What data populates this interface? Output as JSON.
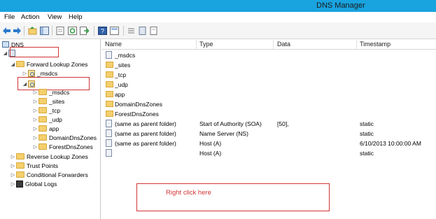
{
  "window": {
    "title": "DNS Manager"
  },
  "menu": [
    "File",
    "Action",
    "View",
    "Help"
  ],
  "tree": {
    "root": "DNS",
    "server": "",
    "forward_lookup_zones": "Forward Lookup Zones",
    "msdcs_zone": "_msdcs",
    "selected_zone": "",
    "subfolders": [
      "_msdcs",
      "_sites",
      "_tcp",
      "_udp",
      "app",
      "DomainDnsZones",
      "ForestDnsZones"
    ],
    "reverse_lookup_zones": "Reverse Lookup Zones",
    "trust_points": "Trust Points",
    "conditional_forwarders": "Conditional Forwarders",
    "global_logs": "Global Logs"
  },
  "list": {
    "columns": [
      "Name",
      "Type",
      "Data",
      "Timestamp"
    ],
    "folders": [
      "_msdcs",
      "_sites",
      "_tcp",
      "_udp",
      "app",
      "DomainDnsZones",
      "ForestDnsZones"
    ],
    "records": [
      {
        "name": "(same as parent folder)",
        "type": "Start of Authority (SOA)",
        "data": "[50],",
        "timestamp": "static"
      },
      {
        "name": "(same as parent folder)",
        "type": "Name Server (NS)",
        "data": "",
        "timestamp": "static"
      },
      {
        "name": "(same as parent folder)",
        "type": "Host (A)",
        "data": "",
        "timestamp": "6/10/2013 10:00:00 AM"
      },
      {
        "name": "",
        "type": "Host (A)",
        "data": "",
        "timestamp": "static"
      }
    ]
  },
  "annotation": {
    "text": "Right click here"
  },
  "colors": {
    "titlebar": "#19a3df",
    "annotation": "#d13434",
    "folder": "#f4cf6d"
  },
  "icons": [
    "back-arrow-icon",
    "forward-arrow-icon",
    "up-folder-icon",
    "show-tree-icon",
    "properties-icon",
    "refresh-icon",
    "export-icon",
    "help-icon",
    "view-icon"
  ]
}
